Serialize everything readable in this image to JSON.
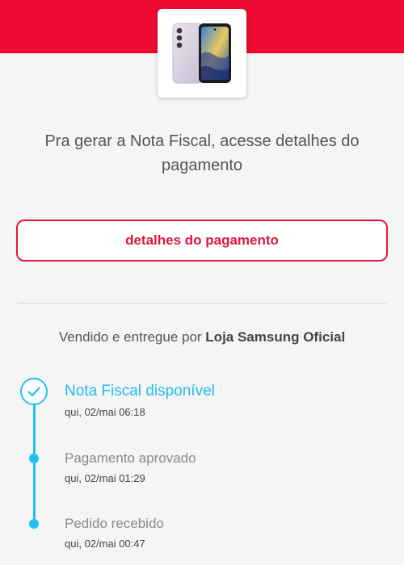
{
  "header": {
    "brand_color": "#ee0a30",
    "product_image_icon": "smartphone-product-image"
  },
  "main": {
    "headline": "Pra gerar a Nota Fiscal, acesse detalhes do pagamento",
    "details_button_label": "detalhes do pagamento",
    "seller_prefix": "Vendido e entregue por ",
    "seller_name": "Loja Samsung Oficial"
  },
  "timeline": {
    "accent_color": "#21c2f5",
    "steps": [
      {
        "title": "Nota Fiscal disponível",
        "time": "qui, 02/mai 06:18",
        "status": "current",
        "icon": "check-icon"
      },
      {
        "title": "Pagamento aprovado",
        "time": "qui, 02/mai 01:29",
        "status": "done",
        "icon": "dot"
      },
      {
        "title": "Pedido recebido",
        "time": "qui, 02/mai 00:47",
        "status": "done",
        "icon": "dot"
      }
    ]
  }
}
